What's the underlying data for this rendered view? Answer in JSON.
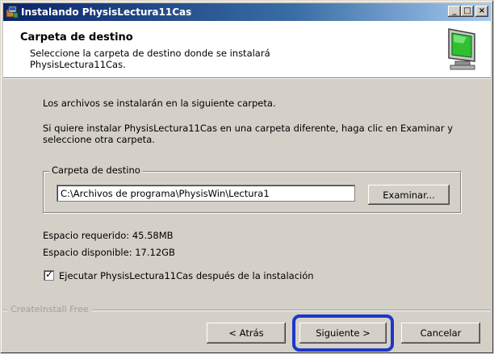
{
  "window": {
    "title": "Instalando PhysisLectura11Cas",
    "controls": {
      "minimize": "_",
      "maximize": "□",
      "close": "×"
    }
  },
  "header": {
    "title": "Carpeta de destino",
    "subtitle": "Seleccione la carpeta de destino donde se instalará PhysisLectura11Cas.",
    "icon": "monitor-icon"
  },
  "body": {
    "intro": "Los archivos se instalarán en la siguiente carpeta.",
    "instructions": "Si quiere instalar PhysisLectura11Cas en una carpeta diferente, haga clic en Examinar y seleccione otra carpeta.",
    "group_label": "Carpeta de destino",
    "path_value": "C:\\Archivos de programa\\PhysisWin\\Lectura1",
    "browse_label": "Examinar...",
    "space_required": "Espacio requerido: 45.58MB",
    "space_available": "Espacio disponible: 17.12GB",
    "run_after_install_label": "Ejecutar PhysisLectura11Cas después de la instalación",
    "run_after_install_checked": true
  },
  "footer": {
    "brand": "CreateInstall Free",
    "back_label": "< Atrás",
    "next_label": "Siguiente >",
    "cancel_label": "Cancelar"
  },
  "colors": {
    "titlebar_start": "#0a246a",
    "titlebar_end": "#a6caf0",
    "dialog_bg": "#d4d0c8",
    "highlight_ring": "#1e36c8"
  }
}
